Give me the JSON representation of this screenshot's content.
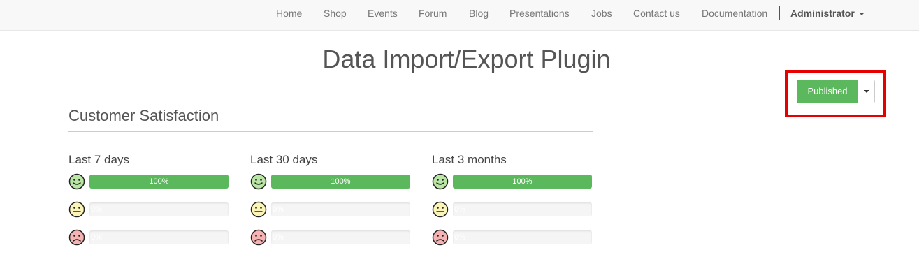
{
  "nav": {
    "items": [
      "Home",
      "Shop",
      "Events",
      "Forum",
      "Blog",
      "Presentations",
      "Jobs",
      "Contact us",
      "Documentation"
    ],
    "user": "Administrator"
  },
  "page": {
    "title": "Data Import/Export Plugin"
  },
  "publish": {
    "label": "Published",
    "highlight_color": "#e60000",
    "color": "#5cb85c"
  },
  "satisfaction": {
    "title": "Customer Satisfaction",
    "periods": [
      {
        "label": "Last 7 days",
        "ratings": [
          {
            "icon": "happy-face-icon",
            "percent": 100,
            "label": "100%"
          },
          {
            "icon": "neutral-face-icon",
            "percent": 0,
            "label": "0%"
          },
          {
            "icon": "sad-face-icon",
            "percent": 0,
            "label": "0%"
          }
        ]
      },
      {
        "label": "Last 30 days",
        "ratings": [
          {
            "icon": "happy-face-icon",
            "percent": 100,
            "label": "100%"
          },
          {
            "icon": "neutral-face-icon",
            "percent": 0,
            "label": "0%"
          },
          {
            "icon": "sad-face-icon",
            "percent": 0,
            "label": "0%"
          }
        ]
      },
      {
        "label": "Last 3 months",
        "ratings": [
          {
            "icon": "happy-face-icon",
            "percent": 100,
            "label": "100%"
          },
          {
            "icon": "neutral-face-icon",
            "percent": 0,
            "label": "0%"
          },
          {
            "icon": "sad-face-icon",
            "percent": 0,
            "label": "0%"
          }
        ]
      }
    ]
  }
}
